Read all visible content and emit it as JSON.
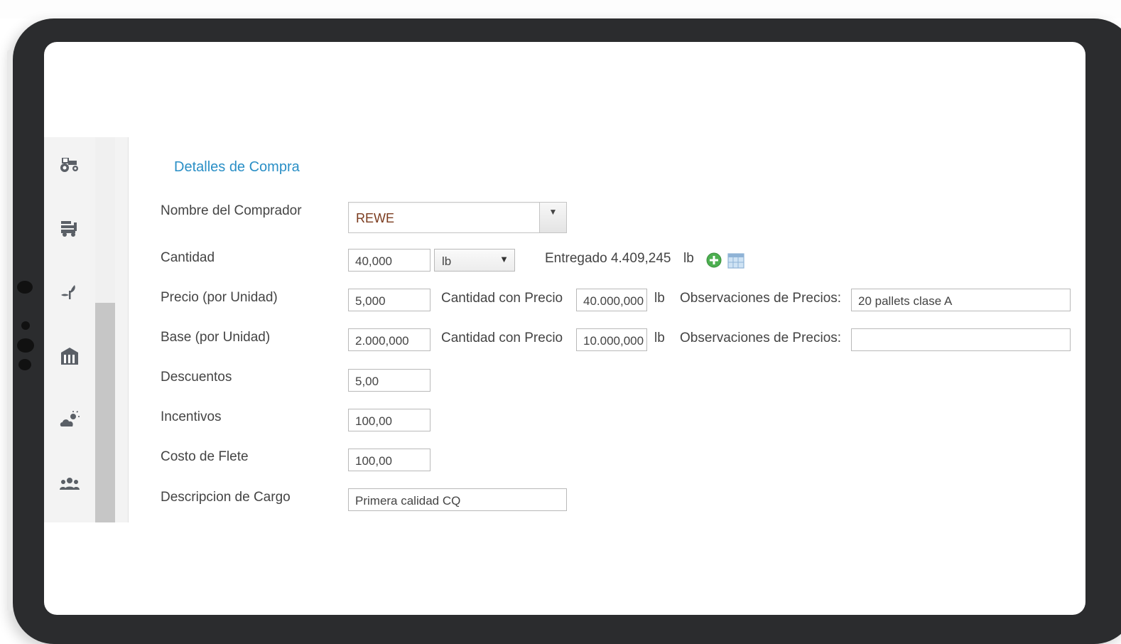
{
  "sidebar": {
    "icons": [
      "tractor-icon",
      "truck-loading-icon",
      "seedling-icon",
      "warehouse-icon",
      "cloud-sun-icon",
      "users-icon"
    ]
  },
  "section": {
    "title": "Detalles de Compra"
  },
  "buyer": {
    "label": "Nombre del Comprador",
    "value": "REWE"
  },
  "quantity": {
    "label": "Cantidad",
    "value": "40,000",
    "unit": "lb",
    "delivered_text": "Entregado 4.409,245",
    "delivered_unit": "lb"
  },
  "price": {
    "label": "Precio (por Unidad)",
    "value": "5,000",
    "qty_label": "Cantidad con Precio",
    "qty_value": "40.000,000",
    "unit": "lb",
    "obs_label": "Observaciones de Precios:",
    "obs_value": "20 pallets clase A"
  },
  "base": {
    "label": "Base (por Unidad)",
    "value": "2.000,000",
    "qty_label": "Cantidad con Precio",
    "qty_value": "10.000,000",
    "unit": "lb",
    "obs_label": "Observaciones de Precios:",
    "obs_value": ""
  },
  "discounts": {
    "label": "Descuentos",
    "value": "5,00"
  },
  "incentives": {
    "label": "Incentivos",
    "value": "100,00"
  },
  "freight": {
    "label": "Costo de Flete",
    "value": "100,00"
  },
  "cargo": {
    "label": "Descripcion de Cargo",
    "value": "Primera calidad CQ"
  },
  "colors": {
    "accent": "#2a8fc6",
    "buyer_text": "#7b3b1e",
    "add_green": "#4caf50"
  }
}
